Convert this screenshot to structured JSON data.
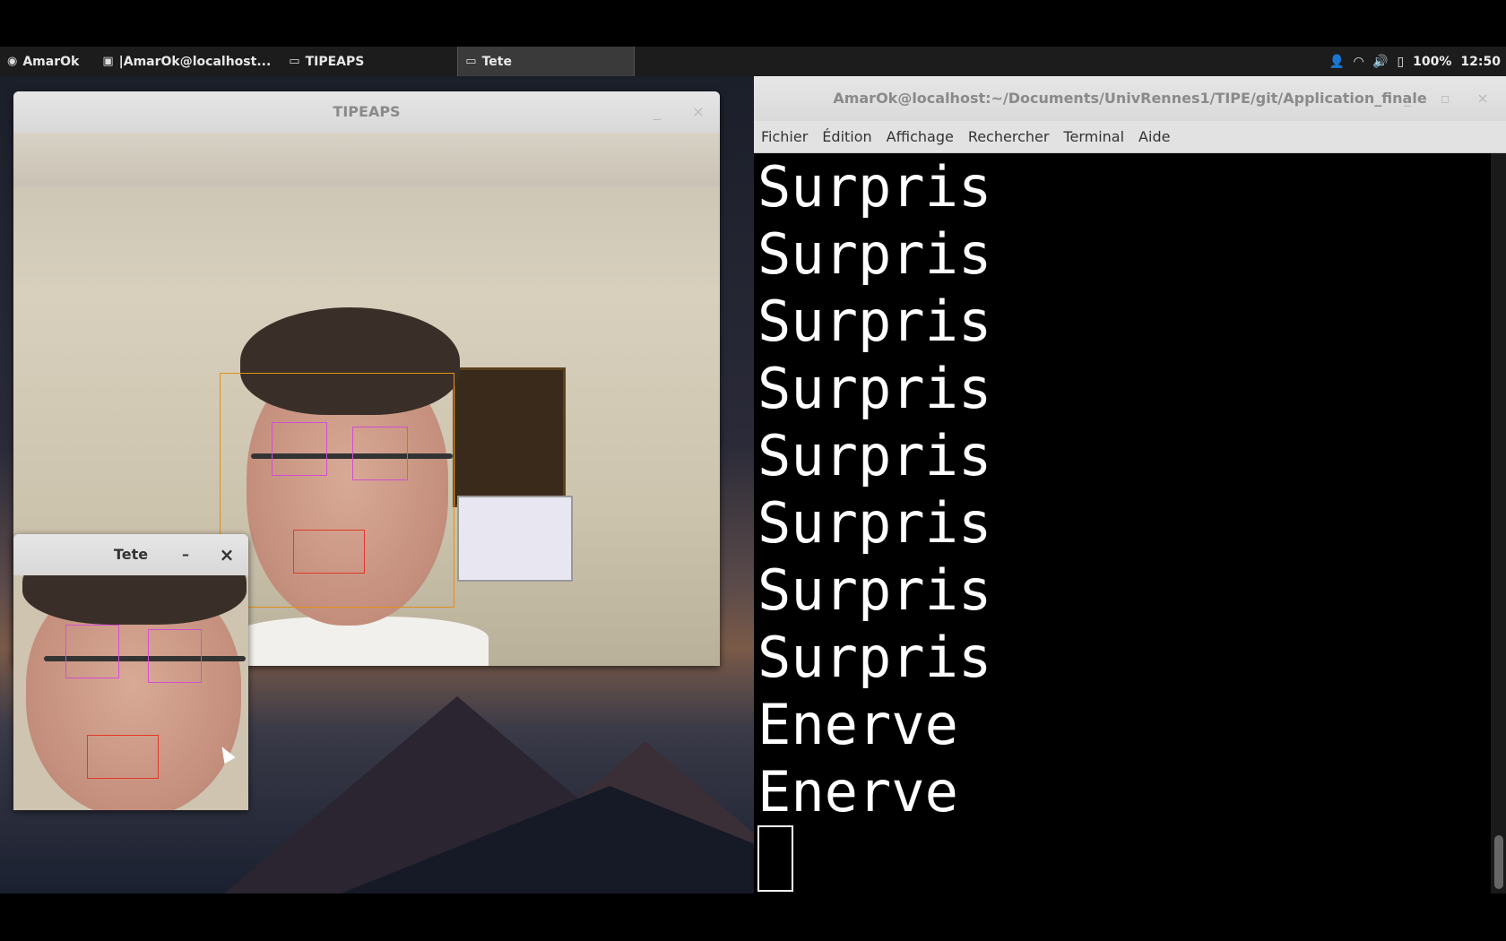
{
  "panel": {
    "app_menu_label": "AmarOk",
    "tasks": [
      {
        "label": "|AmarOk@localhost...",
        "icon": "terminal-icon"
      },
      {
        "label": "TIPEAPS",
        "icon": "window-icon"
      },
      {
        "label": "Tete",
        "icon": "window-icon",
        "active": true
      }
    ],
    "battery": "100%",
    "clock": "12:50",
    "tray_icons": [
      "user-icon",
      "wifi-icon",
      "volume-icon",
      "battery-icon"
    ]
  },
  "tipeaps_window": {
    "title": "TIPEAPS"
  },
  "tete_window": {
    "title": "Tete",
    "minimize_glyph": "–",
    "close_glyph": "×"
  },
  "terminal_window": {
    "title": "AmarOk@localhost:~/Documents/UnivRennes1/TIPE/git/Application_finale",
    "menu": [
      "Fichier",
      "Édition",
      "Affichage",
      "Rechercher",
      "Terminal",
      "Aide"
    ],
    "output_lines": [
      "Surpris",
      "Surpris",
      "Surpris",
      "Surpris",
      "Surpris",
      "Surpris",
      "Surpris",
      "Surpris",
      "Enerve",
      "Enerve"
    ]
  },
  "colors": {
    "face_box": "#e0901c",
    "eye_box": "#d050d0",
    "mouth_box": "#e03a2a"
  }
}
